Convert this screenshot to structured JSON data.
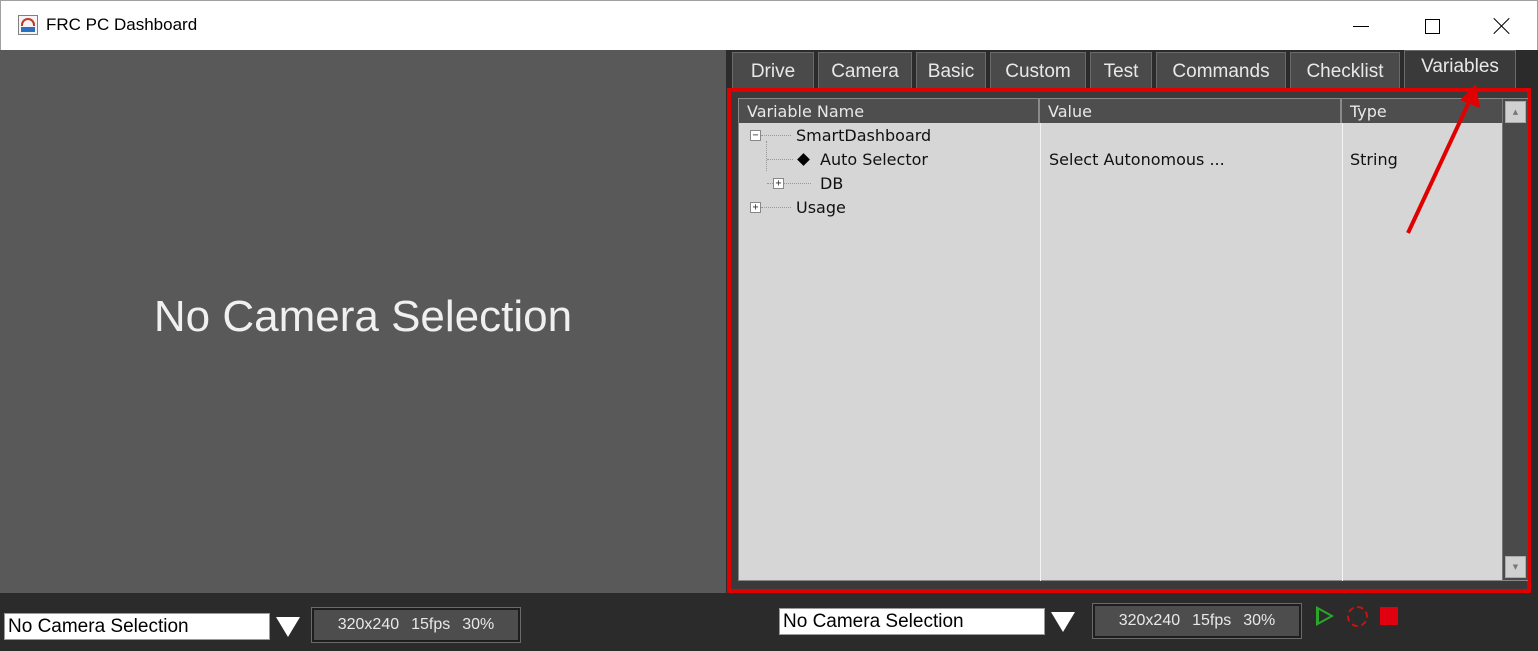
{
  "window": {
    "title": "FRC PC Dashboard"
  },
  "camera_left": {
    "overlay_text": "No Camera Selection",
    "selection": "No Camera Selection",
    "resolution": "320x240",
    "fps": "15fps",
    "quality": "30%"
  },
  "tabs": [
    {
      "label": "Drive",
      "active": false
    },
    {
      "label": "Camera",
      "active": false
    },
    {
      "label": "Basic",
      "active": false
    },
    {
      "label": "Custom",
      "active": false
    },
    {
      "label": "Test",
      "active": false
    },
    {
      "label": "Commands",
      "active": false
    },
    {
      "label": "Checklist",
      "active": false
    },
    {
      "label": "Variables",
      "active": true
    }
  ],
  "variables": {
    "columns": [
      "Variable Name",
      "Value",
      "Type"
    ],
    "rows": [
      {
        "name": "SmartDashboard",
        "value": "",
        "type": "",
        "expanded": true
      },
      {
        "name": "Auto Selector",
        "value": "Select Autonomous ...",
        "type": "String"
      },
      {
        "name": "DB",
        "value": "",
        "type": "",
        "expanded": false
      },
      {
        "name": "Usage",
        "value": "",
        "type": "",
        "expanded": false
      }
    ]
  },
  "camera_right": {
    "selection": "No Camera Selection",
    "resolution": "320x240",
    "fps": "15fps",
    "quality": "30%"
  },
  "colors": {
    "highlight": "#e00000",
    "play": "#2aa72a",
    "record": "#cc1111",
    "stop": "#e00010"
  }
}
